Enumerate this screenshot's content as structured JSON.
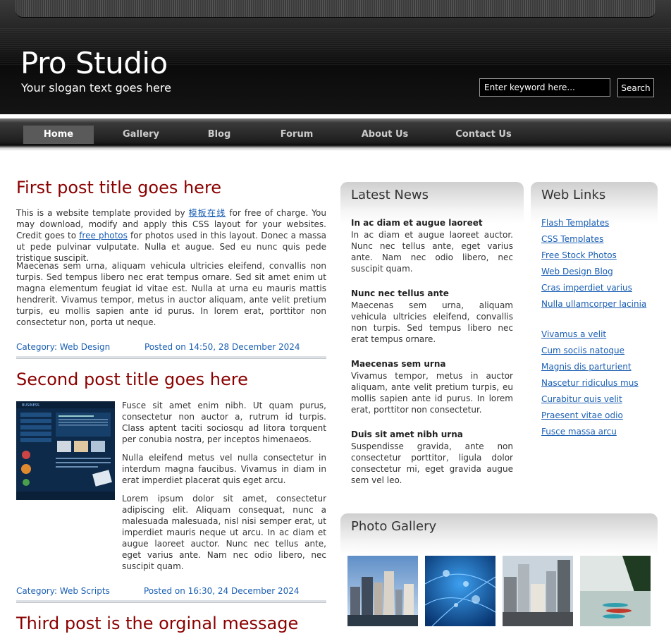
{
  "header": {
    "site_title": "Pro Studio",
    "slogan": "Your slogan text goes here",
    "search_placeholder": "Enter keyword here...",
    "search_button": "Search"
  },
  "menu": [
    {
      "label": "Home",
      "active": true
    },
    {
      "label": "Gallery"
    },
    {
      "label": "Blog"
    },
    {
      "label": "Forum"
    },
    {
      "label": "About Us"
    },
    {
      "label": "Contact Us"
    }
  ],
  "posts": [
    {
      "title": "First post title goes here",
      "p1_before": "This is a website template provided by ",
      "p1_link1": "模板在线",
      "p1_mid": " for free of charge. You may download, modify and apply this CSS layout for your websites. Credit goes to ",
      "p1_link2": "free photos",
      "p1_after": " for photos used in this layout. Donec a massa ut pede pulvinar vulputate. Nulla et augue. Sed eu nunc quis pede tristique suscipit.",
      "p2": "Maecenas sem urna, aliquam vehicula ultricies eleifend, convallis non turpis. Sed tempus libero nec erat tempus ornare. Sed sit amet enim ut magna elementum feugiat id vitae est. Nulla at urna eu mauris mattis hendrerit. Vivamus tempor, metus in auctor aliquam, ante velit pretium turpis, eu mollis sapien ante id purus. In lorem erat, porttitor non consectetur non, porta ut neque.",
      "category": "Category: Web Design",
      "posted": "Posted on 14:50, 28 December 2024"
    },
    {
      "title": "Second post title goes here",
      "p1": "Fusce sit amet enim nibh. Ut quam purus, consectetur non auctor a, rutrum id turpis. Class aptent taciti sociosqu ad litora torquent per conubia nostra, per inceptos himenaeos.",
      "p2": "Nulla eleifend metus vel nulla consectetur in interdum magna faucibus. Vivamus in diam in erat imperdiet placerat quis eget arcu.",
      "p3": "Lorem ipsum dolor sit amet, consectetur adipiscing elit. Aliquam consequat, nunc a malesuada malesuada, nisl nisi semper erat, ut imperdiet mauris neque ut arcu. In ac diam et augue laoreet auctor. Nunc nec tellus ante, eget varius ante. Nam nec odio libero, nec suscipit quam.",
      "category": "Category: Web Scripts",
      "posted": "Posted on 16:30, 24 December 2024"
    },
    {
      "title": "Third post is the orginal message"
    }
  ],
  "latest_news": {
    "heading": "Latest News",
    "items": [
      {
        "title": "In ac diam et augue laoreet",
        "text": "In ac diam et augue laoreet auctor. Nunc nec tellus ante, eget varius ante. Nam nec odio libero, nec suscipit quam."
      },
      {
        "title": "Nunc nec tellus ante",
        "text": "Maecenas sem urna, aliquam vehicula ultricies eleifend, convallis non turpis. Sed tempus libero nec erat tempus ornare."
      },
      {
        "title": "Maecenas sem urna",
        "text": "Vivamus tempor, metus in auctor aliquam, ante velit pretium turpis, eu mollis sapien ante id purus. In lorem erat, porttitor non consectetur."
      },
      {
        "title": "Duis sit amet nibh urna",
        "text": "Suspendisse gravida, ante non consectetur porttitor, ligula dolor consectetur mi, eget gravida augue sem vel leo."
      }
    ]
  },
  "web_links": {
    "heading": "Web Links",
    "group1": [
      "Flash Templates",
      "CSS Templates",
      "Free Stock Photos",
      "Web Design Blog",
      "Cras imperdiet varius",
      "Nulla ullamcorper lacinia"
    ],
    "group2": [
      "Vivamus a velit",
      "Cum sociis natoque",
      "Magnis dis parturient",
      "Nascetur ridiculus mus",
      "Curabitur quis velit",
      "Praesent vitae odio",
      "Fusce massa arcu"
    ]
  },
  "photo_gallery": {
    "heading": "Photo Gallery",
    "photos": [
      "city-skyline-photo",
      "water-drops-photo",
      "city-buildings-photo",
      "lake-boats-photo"
    ]
  },
  "colors": {
    "post_title": "#8b0000",
    "link": "#1a5fb4"
  }
}
